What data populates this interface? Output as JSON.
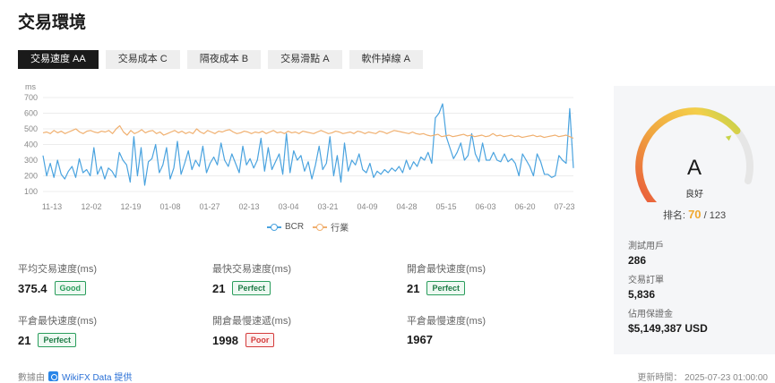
{
  "title": "交易環境",
  "tabs": [
    {
      "label": "交易速度 AA",
      "active": true
    },
    {
      "label": "交易成本 C",
      "active": false
    },
    {
      "label": "隔夜成本 B",
      "active": false
    },
    {
      "label": "交易滑點 A",
      "active": false
    },
    {
      "label": "軟件掉線 A",
      "active": false
    }
  ],
  "chart_data": {
    "type": "line",
    "ylabel": "ms",
    "ylim": [
      100,
      700
    ],
    "yticks": [
      100,
      200,
      300,
      400,
      500,
      600,
      700
    ],
    "xtick_labels": [
      "11-13",
      "12-02",
      "12-19",
      "01-08",
      "01-27",
      "02-13",
      "03-04",
      "03-21",
      "04-09",
      "04-28",
      "05-15",
      "06-03",
      "06-20",
      "07-23"
    ],
    "grid": true,
    "legend_position": "bottom-center",
    "series": [
      {
        "name": "BCR",
        "color": "#4aa3df",
        "values": [
          330,
          200,
          280,
          190,
          300,
          210,
          180,
          230,
          260,
          190,
          310,
          220,
          240,
          200,
          380,
          210,
          260,
          180,
          250,
          230,
          190,
          350,
          300,
          270,
          160,
          450,
          200,
          380,
          140,
          290,
          310,
          400,
          220,
          270,
          380,
          180,
          250,
          420,
          210,
          280,
          360,
          240,
          300,
          260,
          390,
          220,
          280,
          320,
          270,
          410,
          300,
          260,
          340,
          280,
          220,
          390,
          270,
          310,
          250,
          300,
          440,
          230,
          380,
          240,
          290,
          340,
          210,
          470,
          220,
          360,
          300,
          330,
          230,
          290,
          180,
          270,
          390,
          240,
          280,
          450,
          200,
          330,
          160,
          410,
          230,
          300,
          270,
          340,
          240,
          220,
          280,
          190,
          230,
          210,
          240,
          220,
          250,
          230,
          260,
          220,
          300,
          240,
          290,
          260,
          320,
          300,
          350,
          280,
          570,
          600,
          660,
          450,
          380,
          310,
          350,
          410,
          300,
          330,
          470,
          340,
          290,
          410,
          300,
          300,
          350,
          300,
          290,
          340,
          290,
          310,
          280,
          200,
          340,
          300,
          260,
          200,
          340,
          290,
          210,
          210,
          190,
          200,
          330,
          300,
          280,
          630,
          250
        ]
      },
      {
        "name": "行業",
        "color": "#f0b070",
        "values": [
          475,
          480,
          470,
          490,
          475,
          485,
          470,
          480,
          490,
          500,
          480,
          470,
          485,
          490,
          480,
          475,
          485,
          480,
          490,
          470,
          500,
          520,
          480,
          460,
          490,
          470,
          480,
          495,
          475,
          485,
          490,
          470,
          480,
          460,
          470,
          480,
          490,
          475,
          485,
          470,
          480,
          470,
          500,
          480,
          470,
          490,
          480,
          470,
          485,
          480,
          490,
          495,
          480,
          470,
          475,
          485,
          480,
          470,
          480,
          475,
          485,
          470,
          480,
          490,
          475,
          480,
          470,
          485,
          475,
          480,
          470,
          485,
          480,
          475,
          470,
          480,
          490,
          480,
          470,
          475,
          485,
          480,
          470,
          475,
          480,
          470,
          485,
          480,
          470,
          480,
          475,
          470,
          485,
          480,
          470,
          480,
          490,
          485,
          480,
          475,
          470,
          480,
          470,
          465,
          470,
          460,
          455,
          460,
          465,
          450,
          455,
          460,
          450,
          455,
          460,
          465,
          455,
          460,
          450,
          455,
          460,
          450,
          455,
          470,
          455,
          460,
          450,
          455,
          460,
          450,
          455,
          445,
          450,
          455,
          460,
          450,
          455,
          445,
          450,
          455,
          460,
          450,
          455,
          460,
          450,
          440
        ]
      }
    ]
  },
  "stats": [
    {
      "label": "平均交易速度(ms)",
      "value": "375.4",
      "badge": "Good",
      "badge_type": "good"
    },
    {
      "label": "最快交易速度(ms)",
      "value": "21",
      "badge": "Perfect",
      "badge_type": "perfect"
    },
    {
      "label": "開倉最快速度(ms)",
      "value": "21",
      "badge": "Perfect",
      "badge_type": "perfect"
    },
    {
      "label": "平倉最快速度(ms)",
      "value": "21",
      "badge": "Perfect",
      "badge_type": "perfect"
    },
    {
      "label": "開倉最慢速遞(ms)",
      "value": "1998",
      "badge": "Poor",
      "badge_type": "poor"
    },
    {
      "label": "平倉最慢速度(ms)",
      "value": "1967",
      "badge": "",
      "badge_type": ""
    }
  ],
  "side": {
    "grade": "A",
    "grade_text": "良好",
    "rank_label": "排名:",
    "rank_value": "70",
    "rank_total": "/ 123",
    "gauge_fraction": 0.78,
    "info": [
      {
        "label": "測試用戶",
        "value": "286"
      },
      {
        "label": "交易訂單",
        "value": "5,836"
      },
      {
        "label": "佔用保證金",
        "value": "$5,149,387 USD"
      }
    ]
  },
  "footer": {
    "prefix": "數據由",
    "link": "WikiFX Data 提供",
    "updated": "更新時間： 2025-07-23 01:00:00"
  }
}
